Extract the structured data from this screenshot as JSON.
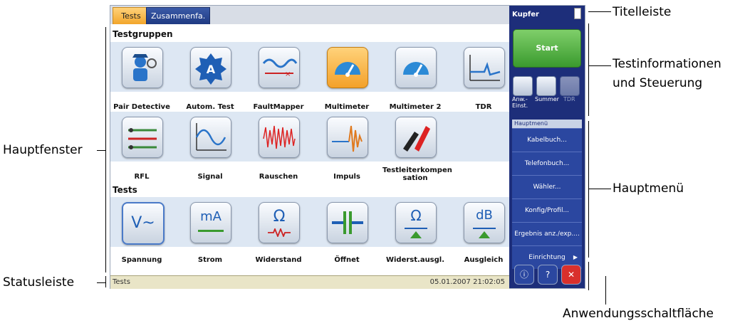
{
  "callouts": {
    "titelleiste": "Titelleiste",
    "testinfo_line1": "Testinformationen",
    "testinfo_line2": "und Steuerung",
    "hauptfenster": "Hauptfenster",
    "hauptmenue": "Hauptmenü",
    "statusleiste": "Statusleiste",
    "anwendung": "Anwendungsschaltfläche"
  },
  "tabs": [
    "Tests",
    "Zusammenfa."
  ],
  "sections": {
    "groups": "Testgruppen",
    "tests": "Tests"
  },
  "testgroups": [
    {
      "label": "Pair Detective",
      "icon": "detective-icon"
    },
    {
      "label": "Autom. Test",
      "icon": "auto-test-icon"
    },
    {
      "label": "FaultMapper",
      "icon": "fault-mapper-icon"
    },
    {
      "label": "Multimeter",
      "icon": "gauge-icon",
      "selected": true
    },
    {
      "label": "Multimeter 2",
      "icon": "gauge-icon"
    },
    {
      "label": "TDR",
      "icon": "tdr-trace-icon"
    },
    {
      "label": "RFL",
      "icon": "rfl-icon"
    },
    {
      "label": "Signal",
      "icon": "sine-wave-icon"
    },
    {
      "label": "Rauschen",
      "icon": "noise-icon"
    },
    {
      "label": "Impuls",
      "icon": "impulse-icon"
    },
    {
      "label": "Testleiterkompen sation",
      "icon": "test-leads-icon"
    }
  ],
  "tests": [
    {
      "label": "Spannung",
      "icon": "voltage-icon",
      "glyph": "V~"
    },
    {
      "label": "Strom",
      "icon": "current-icon",
      "glyph": "mA"
    },
    {
      "label": "Widerstand",
      "icon": "resistance-icon",
      "glyph": "Ω"
    },
    {
      "label": "Öffnet",
      "icon": "capacitor-icon",
      "glyph": "-||-"
    },
    {
      "label": "Widerst.ausgl.",
      "icon": "resistance-balance-icon",
      "glyph": "Ω"
    },
    {
      "label": "Ausgleich",
      "icon": "db-balance-icon",
      "glyph": "dB"
    }
  ],
  "status": {
    "left": "Tests",
    "datetime": "05.01.2007 21:02:05"
  },
  "panel": {
    "title": "Kupfer",
    "start": "Start",
    "small_buttons": [
      {
        "label": "Anw.-Einst.",
        "icon": "wrench-icon"
      },
      {
        "label": "Summer",
        "icon": "speaker-icon"
      },
      {
        "label": "TDR",
        "icon": "tdr-trace-icon"
      }
    ],
    "menu_header": "Hauptmenü",
    "menu": [
      "Kabelbuch...",
      "Telefonbuch...",
      "Wähler...",
      "Konfig/Profil...",
      "Ergebnis anz./exp....",
      "Einrichtung"
    ],
    "app_buttons": [
      {
        "icon": "info-icon",
        "glyph": "ⓘ"
      },
      {
        "icon": "help-icon",
        "glyph": "?"
      },
      {
        "icon": "close-icon",
        "glyph": "✕"
      }
    ]
  },
  "colors": {
    "panel": "#1d2e7a",
    "start": "#4caf3c",
    "selected": "#f3a12a",
    "status": "#e9e5c7"
  }
}
